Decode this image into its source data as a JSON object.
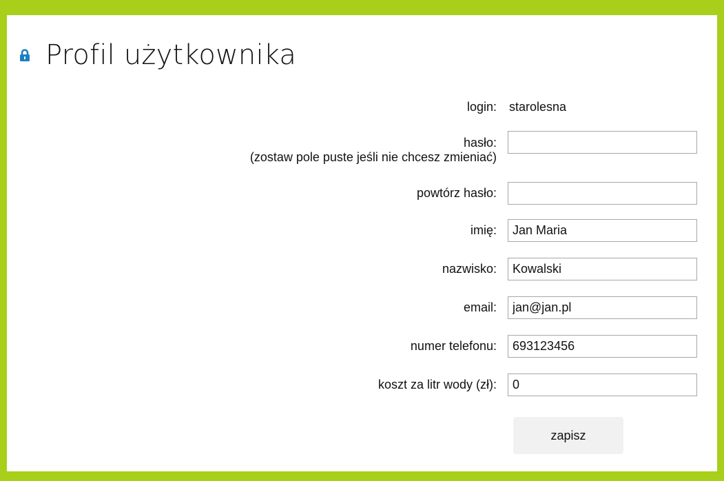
{
  "header": {
    "title": "Profil użytkownika"
  },
  "colors": {
    "frame": "#a8cf1a",
    "lock_icon": "#1e7fc0"
  },
  "form": {
    "login_label": "login:",
    "login_value": "starolesna",
    "password_label": "hasło:",
    "password_hint": "(zostaw pole puste jeśli nie chcesz zmieniać)",
    "password_value": "",
    "repeat_password_label": "powtórz hasło:",
    "repeat_password_value": "",
    "first_name_label": "imię:",
    "first_name_value": "Jan Maria",
    "last_name_label": "nazwisko:",
    "last_name_value": "Kowalski",
    "email_label": "email:",
    "email_value": "jan@jan.pl",
    "phone_label": "numer telefonu:",
    "phone_value": "693123456",
    "water_cost_label": "koszt za litr wody (zł):",
    "water_cost_value": "0",
    "save_label": "zapisz"
  }
}
